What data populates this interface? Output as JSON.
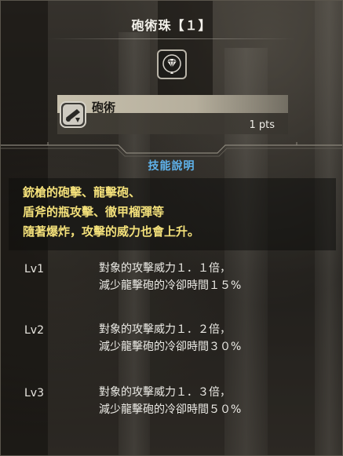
{
  "header": {
    "title": "砲術珠【１】"
  },
  "decoration": {
    "icon": "jewel-gem-icon"
  },
  "skill": {
    "icon": "cannon-skill-icon",
    "name": "砲術",
    "points": "1 pts"
  },
  "description": {
    "heading": "技能說明",
    "lines": [
      "銃槍的砲擊、龍擊砲、",
      "盾斧的瓶攻擊、徹甲榴彈等",
      "隨著爆炸，攻擊的威力也會上升。"
    ]
  },
  "levels": [
    {
      "label": "Lv1",
      "line1": "對象的攻擊威力１．１倍，",
      "line2": "減少龍擊砲的冷卻時間１５%"
    },
    {
      "label": "Lv2",
      "line1": "對象的攻擊威力１．２倍，",
      "line2": "減少龍擊砲的冷卻時間３０%"
    },
    {
      "label": "Lv3",
      "line1": "對象的攻擊威力１．３倍，",
      "line2": "減少龍擊砲的冷卻時間５０%"
    }
  ],
  "colors": {
    "heading_blue": "#5fb3ec",
    "description_yellow": "#f3e07a",
    "text_white": "#ecebe6"
  }
}
